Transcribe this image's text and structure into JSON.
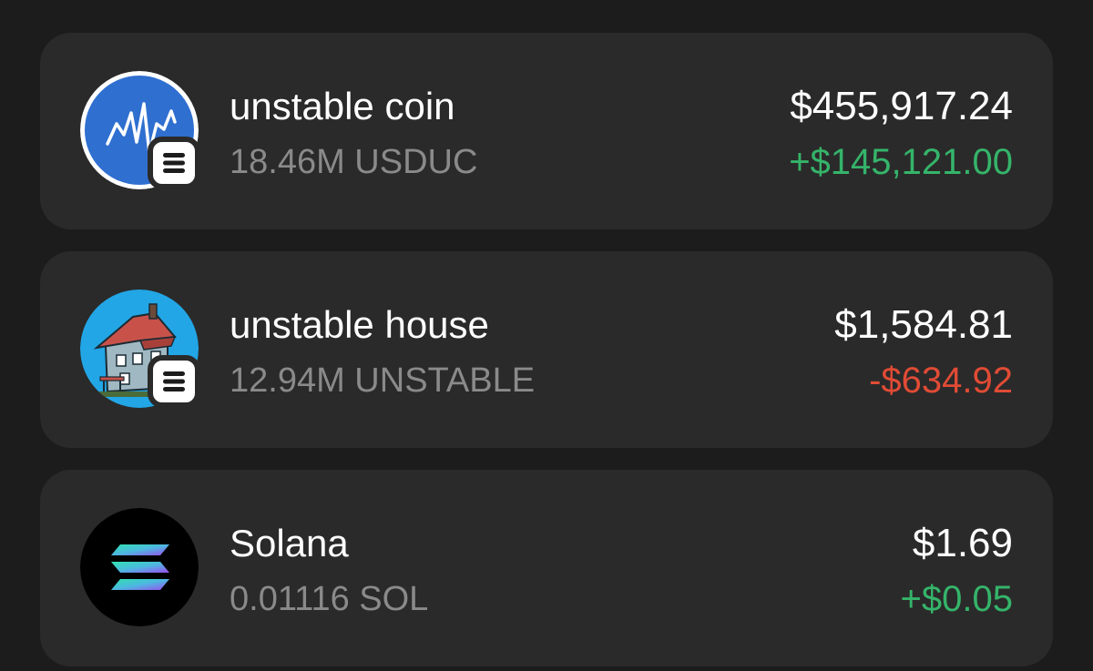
{
  "tokens": [
    {
      "name": "unstable coin",
      "balance": "18.46M USDUC",
      "value": "$455,917.24",
      "change": "+$145,121.00",
      "direction": "up",
      "icon": "unstable-coin-chart-icon",
      "badge_icon": "network-badge-icon"
    },
    {
      "name": "unstable house",
      "balance": "12.94M UNSTABLE",
      "value": "$1,584.81",
      "change": "-$634.92",
      "direction": "down",
      "icon": "unstable-house-icon",
      "badge_icon": "network-badge-icon"
    },
    {
      "name": "Solana",
      "balance": "0.01116 SOL",
      "value": "$1.69",
      "change": "+$0.05",
      "direction": "up",
      "icon": "solana-logo-icon"
    }
  ],
  "colors": {
    "background": "#1c1c1c",
    "card": "#2a2a2a",
    "positive": "#35b46a",
    "negative": "#e14b35",
    "muted": "#8a8a8a",
    "coin_blue": "#2f6fd0",
    "house_blue": "#22a6e6"
  }
}
